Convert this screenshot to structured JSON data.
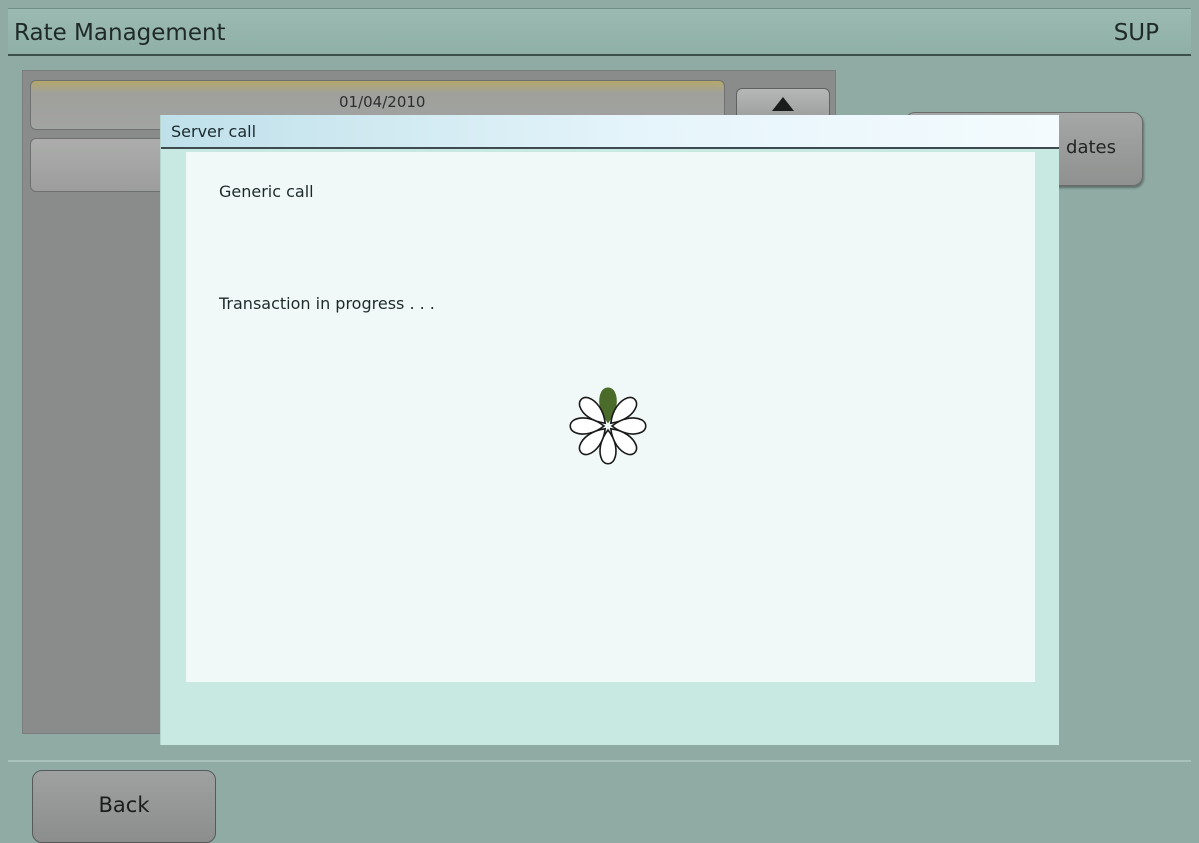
{
  "header": {
    "title": "Rate Management",
    "user": "SUP"
  },
  "list": {
    "selected_row_date": "01/04/2010"
  },
  "updates_button": {
    "label": "dates"
  },
  "back_button": {
    "label": "Back"
  },
  "dialog": {
    "title": "Server call",
    "call_name": "Generic call",
    "status": "Transaction in progress . . ."
  },
  "colors": {
    "spinner_active": "#4a6b2a",
    "spinner_outline": "#1a1a1a"
  },
  "icons": {
    "scroll_up": "triangle-up-icon",
    "loading": "loading-spinner-icon"
  }
}
